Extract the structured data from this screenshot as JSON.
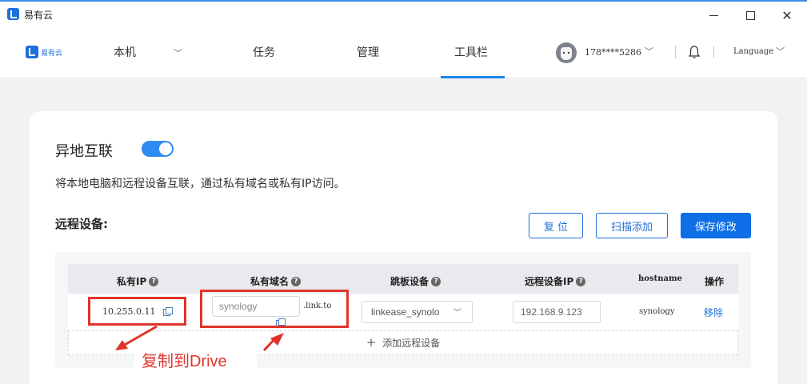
{
  "window": {
    "title": "易有云"
  },
  "nav": {
    "brand": "易有云",
    "items": [
      "本机",
      "任务",
      "管理",
      "工具栏"
    ],
    "active_index": 3,
    "user": "178****5286",
    "language": "Language"
  },
  "section": {
    "title": "异地互联",
    "toggle_on": true,
    "description": "将本地电脑和远程设备互联，通过私有域名或私有IP访问。",
    "remote_label": "远程设备:",
    "buttons": {
      "reset": "复 位",
      "scan": "扫描添加",
      "save": "保存修改"
    }
  },
  "table": {
    "headers": [
      "私有IP",
      "私有域名",
      "跳板设备",
      "远程设备IP",
      "hostname",
      "操作"
    ],
    "rows": [
      {
        "private_ip": "10.255.0.11",
        "domain_value": "synology",
        "domain_suffix": ".link.to",
        "jump_device": "linkease_synolo",
        "remote_ip": "192.168.9.123",
        "hostname": "synology",
        "action": "移除"
      }
    ],
    "add_label": "添加远程设备"
  },
  "annotation": {
    "label": "复制到Drive"
  },
  "colors": {
    "accent": "#1e6fd9",
    "toggle": "#2e8cf0",
    "annotation": "#e0342b"
  },
  "icons": [
    "minimize-icon",
    "maximize-icon",
    "close-icon",
    "chevron-down-icon",
    "bell-icon",
    "help-icon",
    "copy-icon",
    "plus-icon"
  ]
}
